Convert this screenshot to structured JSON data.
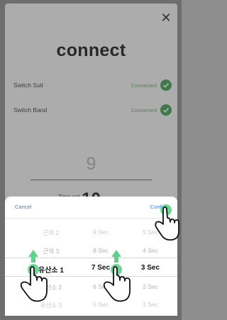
{
  "modal": {
    "close_icon": "close-icon",
    "title": "connect",
    "devices": [
      {
        "name": "Switch Suit",
        "status": "Connected"
      },
      {
        "name": "Switch Band",
        "status": "Connected"
      }
    ],
    "background_picker": {
      "prev_value": "9",
      "current_value": "10",
      "label": "Time set"
    }
  },
  "sheet": {
    "cancel_label": "Cancel",
    "confirm_label": "Confirm",
    "columns": [
      {
        "items": [
          "근력 2",
          "근력 3",
          "유산소 1",
          "유산소 2",
          "유산소 3"
        ],
        "selected_index": 2
      },
      {
        "items": [
          "9 Sec",
          "8 Sec",
          "7 Sec",
          "6 Sec",
          "5 Sec"
        ],
        "selected_index": 2
      },
      {
        "items": [
          "5 Sec",
          "4 Sec",
          "3 Sec",
          "2 Sec",
          "1 Sec"
        ],
        "selected_index": 2
      }
    ]
  },
  "colors": {
    "accent_blue": "#3b7dd8",
    "connected_green": "#3aa34a",
    "gesture_green": "#5fd18a"
  },
  "icons": [
    "close-icon",
    "check-circle-icon",
    "hand-pointer-icon",
    "swipe-up-arrow-icon"
  ]
}
